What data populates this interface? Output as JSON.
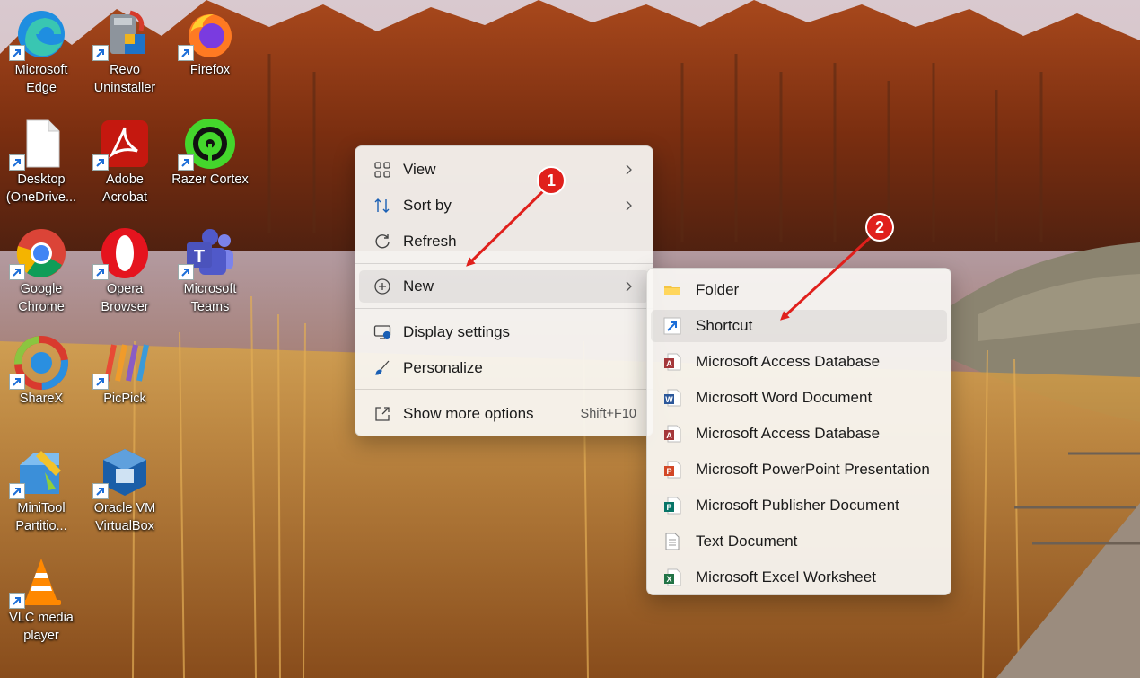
{
  "desktop": {
    "icons": [
      {
        "label": "Microsoft Edge",
        "icon": "edge-icon"
      },
      {
        "label": "Revo Uninstaller",
        "icon": "revo-uninstaller-icon"
      },
      {
        "label": "Firefox",
        "icon": "firefox-icon"
      },
      {
        "label": "Desktop (OneDrive...",
        "icon": "document-icon"
      },
      {
        "label": "Adobe Acrobat",
        "icon": "acrobat-icon"
      },
      {
        "label": "Razer Cortex",
        "icon": "razer-cortex-icon"
      },
      {
        "label": "Google Chrome",
        "icon": "chrome-icon"
      },
      {
        "label": "Opera Browser",
        "icon": "opera-icon"
      },
      {
        "label": "Microsoft Teams",
        "icon": "teams-icon"
      },
      {
        "label": "ShareX",
        "icon": "sharex-icon"
      },
      {
        "label": "PicPick",
        "icon": "picpick-icon"
      },
      {
        "label": "MiniTool Partitio...",
        "icon": "minitool-icon"
      },
      {
        "label": "Oracle VM VirtualBox",
        "icon": "virtualbox-icon"
      },
      {
        "label": "VLC media player",
        "icon": "vlc-icon"
      }
    ]
  },
  "context_menu": {
    "items": [
      {
        "label": "View",
        "icon": "grid-view-icon",
        "submenu": true
      },
      {
        "label": "Sort by",
        "icon": "sort-icon",
        "submenu": true
      },
      {
        "label": "Refresh",
        "icon": "refresh-icon",
        "submenu": false
      },
      {
        "label": "New",
        "icon": "plus-circle-icon",
        "submenu": true
      },
      {
        "label": "Display settings",
        "icon": "display-settings-icon",
        "submenu": false
      },
      {
        "label": "Personalize",
        "icon": "brush-icon",
        "submenu": false
      },
      {
        "label": "Show more options",
        "icon": "share-more-icon",
        "shortcut": "Shift+F10"
      }
    ]
  },
  "new_submenu": {
    "items": [
      {
        "label": "Folder",
        "icon": "folder-icon"
      },
      {
        "label": "Shortcut",
        "icon": "shortcut-icon"
      },
      {
        "label": "Microsoft Access Database",
        "icon": "access-icon"
      },
      {
        "label": "Microsoft Word Document",
        "icon": "word-icon"
      },
      {
        "label": "Microsoft Access Database",
        "icon": "access-icon"
      },
      {
        "label": "Microsoft PowerPoint Presentation",
        "icon": "powerpoint-icon"
      },
      {
        "label": "Microsoft Publisher Document",
        "icon": "publisher-icon"
      },
      {
        "label": "Text Document",
        "icon": "text-document-icon"
      },
      {
        "label": "Microsoft Excel Worksheet",
        "icon": "excel-icon"
      }
    ]
  },
  "annotations": [
    {
      "number": "1"
    },
    {
      "number": "2"
    }
  ],
  "colors": {
    "annotation_red": "#e0201c",
    "menu_background": "#f9f7f4",
    "highlight": "#ebe9e6"
  }
}
